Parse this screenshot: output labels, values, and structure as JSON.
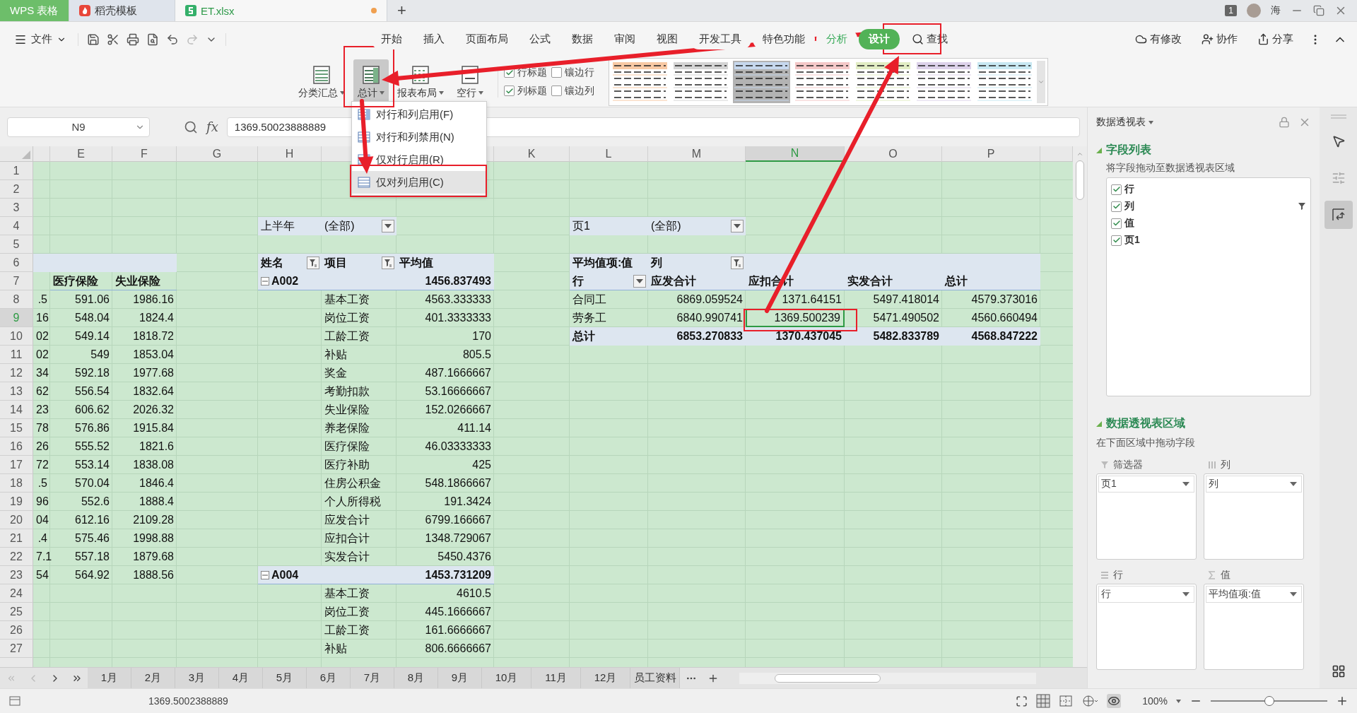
{
  "title_bar": {
    "tabs": [
      {
        "label": "WPS 表格",
        "kind": "home",
        "selected": false,
        "unsaved": false
      },
      {
        "label": "稻壳模板",
        "kind": "docer",
        "selected": false,
        "unsaved": false
      },
      {
        "label": "ET.xlsx",
        "kind": "sheet",
        "selected": true,
        "unsaved": true
      }
    ],
    "new_tab": "+",
    "badge": "1",
    "user": "海"
  },
  "menu_bar": {
    "file": "文件",
    "tabs": [
      {
        "label": "开始",
        "selected": false,
        "contextual": false
      },
      {
        "label": "插入",
        "selected": false,
        "contextual": false
      },
      {
        "label": "页面布局",
        "selected": false,
        "contextual": false
      },
      {
        "label": "公式",
        "selected": false,
        "contextual": false
      },
      {
        "label": "数据",
        "selected": false,
        "contextual": false
      },
      {
        "label": "审阅",
        "selected": false,
        "contextual": false
      },
      {
        "label": "视图",
        "selected": false,
        "contextual": false
      },
      {
        "label": "开发工具",
        "selected": false,
        "contextual": false
      },
      {
        "label": "特色功能",
        "selected": false,
        "contextual": false
      },
      {
        "label": "分析",
        "selected": false,
        "contextual": true
      },
      {
        "label": "设计",
        "selected": true,
        "contextual": true
      }
    ],
    "search": "查找",
    "actions": [
      {
        "label": "有修改",
        "kind": "cloud"
      },
      {
        "label": "协作",
        "kind": "people"
      },
      {
        "label": "分享",
        "kind": "share"
      }
    ]
  },
  "ribbon": {
    "buttons": [
      {
        "label": "分类汇总",
        "kind": "subtotal",
        "active": false
      },
      {
        "label": "总计",
        "kind": "total",
        "active": true
      },
      {
        "label": "报表布局",
        "kind": "layout",
        "active": false
      },
      {
        "label": "空行",
        "kind": "blank",
        "active": false
      }
    ],
    "options": [
      {
        "label": "行标题",
        "checked": true
      },
      {
        "label": "镶边行",
        "checked": false
      },
      {
        "label": "列标题",
        "checked": true
      },
      {
        "label": "镶边列",
        "checked": false
      }
    ],
    "styles": [
      {
        "color": "#f8c9a4",
        "selected": false
      },
      {
        "color": "#d4d4d4",
        "selected": false
      },
      {
        "color": "#c6d8ee",
        "selected": true
      },
      {
        "color": "#f4c8c8",
        "selected": false
      },
      {
        "color": "#e2edc4",
        "selected": false
      },
      {
        "color": "#ddd2ea",
        "selected": false
      },
      {
        "color": "#c8e8f2",
        "selected": false
      }
    ]
  },
  "dropdown": {
    "items": [
      {
        "label": "对行和列启用(F)",
        "selected": false
      },
      {
        "label": "对行和列禁用(N)",
        "selected": false
      },
      {
        "label": "仅对行启用(R)",
        "selected": false
      },
      {
        "label": "仅对列启用(C)",
        "selected": true
      }
    ]
  },
  "formula_bar": {
    "cell": "N9",
    "fx": "fx",
    "formula": "1369.50023888889"
  },
  "sheet": {
    "columns": [
      {
        "label": "E",
        "selected": false
      },
      {
        "label": "F",
        "selected": false
      },
      {
        "label": "G",
        "selected": false
      },
      {
        "label": "H",
        "selected": false
      },
      {
        "label": "K",
        "selected": false
      },
      {
        "label": "L",
        "selected": false
      },
      {
        "label": "M",
        "selected": false
      },
      {
        "label": "N",
        "selected": true
      },
      {
        "label": "O",
        "selected": false
      },
      {
        "label": "P",
        "selected": false
      }
    ],
    "rows": [
      {
        "label": "1",
        "selected": false
      },
      {
        "label": "2",
        "selected": false
      },
      {
        "label": "3",
        "selected": false
      },
      {
        "label": "4",
        "selected": false
      },
      {
        "label": "5",
        "selected": false
      },
      {
        "label": "6",
        "selected": false
      },
      {
        "label": "7",
        "selected": false
      },
      {
        "label": "8",
        "selected": false
      },
      {
        "label": "9",
        "selected": true
      },
      {
        "label": "10",
        "selected": false
      },
      {
        "label": "11",
        "selected": false
      },
      {
        "label": "12",
        "selected": false
      },
      {
        "label": "13",
        "selected": false
      },
      {
        "label": "14",
        "selected": false
      },
      {
        "label": "15",
        "selected": false
      },
      {
        "label": "16",
        "selected": false
      },
      {
        "label": "17",
        "selected": false
      },
      {
        "label": "18",
        "selected": false
      },
      {
        "label": "19",
        "selected": false
      },
      {
        "label": "20",
        "selected": false
      },
      {
        "label": "21",
        "selected": false
      },
      {
        "label": "22",
        "selected": false
      },
      {
        "label": "23",
        "selected": false
      },
      {
        "label": "24",
        "selected": false
      },
      {
        "label": "25",
        "selected": false
      },
      {
        "label": "26",
        "selected": false
      },
      {
        "label": "27",
        "selected": false
      }
    ],
    "salary_table": {
      "header": [
        "医疗保险",
        "失业保险"
      ],
      "rows": [
        [
          ".5",
          "591.06",
          "1986.16"
        ],
        [
          "16",
          "548.04",
          "1824.4"
        ],
        [
          "02",
          "549.14",
          "1818.72"
        ],
        [
          "02",
          "549",
          "1853.04"
        ],
        [
          "34",
          "592.18",
          "1977.68"
        ],
        [
          "62",
          "556.54",
          "1832.64"
        ],
        [
          "23",
          "606.62",
          "2026.32"
        ],
        [
          "78",
          "576.86",
          "1915.84"
        ],
        [
          "26",
          "555.52",
          "1821.6"
        ],
        [
          "72",
          "553.14",
          "1838.08"
        ],
        [
          ".5",
          "570.04",
          "1846.4"
        ],
        [
          "96",
          "552.6",
          "1888.4"
        ],
        [
          "04",
          "612.16",
          "2109.28"
        ],
        [
          ".4",
          "575.46",
          "1998.88"
        ],
        [
          "7.1",
          "557.18",
          "1879.68"
        ],
        [
          "54",
          "564.92",
          "1888.56"
        ]
      ]
    },
    "pivot_by_name": {
      "filter": {
        "label": "上半年",
        "value": "(全部)"
      },
      "header": [
        "姓名",
        "项目",
        "平均值"
      ],
      "groups": [
        {
          "name": "A002",
          "value": "1456.837493",
          "expanded": true,
          "items": [
            {
              "label": "基本工资",
              "value": "4563.333333"
            },
            {
              "label": "岗位工资",
              "value": "401.3333333"
            },
            {
              "label": "工龄工资",
              "value": "170"
            },
            {
              "label": "补贴",
              "value": "805.5"
            },
            {
              "label": "奖金",
              "value": "487.1666667"
            },
            {
              "label": "考勤扣款",
              "value": "53.16666667"
            },
            {
              "label": "失业保险",
              "value": "152.0266667"
            },
            {
              "label": "养老保险",
              "value": "411.14"
            },
            {
              "label": "医疗保险",
              "value": "46.03333333"
            },
            {
              "label": "医疗补助",
              "value": "425"
            },
            {
              "label": "住房公积金",
              "value": "548.1866667"
            },
            {
              "label": "个人所得税",
              "value": "191.3424"
            },
            {
              "label": "应发合计",
              "value": "6799.166667"
            },
            {
              "label": "应扣合计",
              "value": "1348.729067"
            },
            {
              "label": "实发合计",
              "value": "5450.4376"
            }
          ]
        },
        {
          "name": "A004",
          "value": "1453.731209",
          "expanded": true,
          "items": [
            {
              "label": "基本工资",
              "value": "4610.5"
            },
            {
              "label": "岗位工资",
              "value": "445.1666667"
            },
            {
              "label": "工龄工资",
              "value": "161.6666667"
            },
            {
              "label": "补贴",
              "value": "806.6666667"
            }
          ]
        }
      ]
    },
    "pivot_by_type": {
      "filter": {
        "label": "页1",
        "value": "(全部)"
      },
      "corner": "平均值项:值",
      "column_field": "列",
      "row_field": "行",
      "columns": [
        "应发合计",
        "应扣合计",
        "实发合计",
        "总计"
      ],
      "rows": [
        {
          "label": "合同工",
          "total": false,
          "values": [
            {
              "text": "6869.059524",
              "selected": false
            },
            {
              "text": "1371.64151",
              "selected": false
            },
            {
              "text": "5497.418014",
              "selected": false
            },
            {
              "text": "4579.373016",
              "selected": false
            }
          ]
        },
        {
          "label": "劳务工",
          "total": false,
          "values": [
            {
              "text": "6840.990741",
              "selected": false
            },
            {
              "text": "1369.500239",
              "selected": true
            },
            {
              "text": "5471.490502",
              "selected": false
            },
            {
              "text": "4560.660494",
              "selected": false
            }
          ]
        },
        {
          "label": "总计",
          "total": true,
          "values": [
            {
              "text": "6853.270833",
              "selected": false
            },
            {
              "text": "1370.437045",
              "selected": false
            },
            {
              "text": "5482.833789",
              "selected": false
            },
            {
              "text": "4568.847222",
              "selected": false
            }
          ]
        }
      ]
    }
  },
  "sheet_tabs": [
    "1月",
    "2月",
    "3月",
    "4月",
    "5月",
    "6月",
    "7月",
    "8月",
    "9月",
    "10月",
    "11月",
    "12月",
    "员工资料"
  ],
  "pivot_panel": {
    "title": "数据透视表",
    "field_list_title": "字段列表",
    "field_list_hint": "将字段拖动至数据透视表区域",
    "fields": [
      {
        "label": "行",
        "checked": true,
        "filtered": false
      },
      {
        "label": "列",
        "checked": true,
        "filtered": true
      },
      {
        "label": "值",
        "checked": true,
        "filtered": false
      },
      {
        "label": "页1",
        "checked": true,
        "filtered": false
      }
    ],
    "areas_title": "数据透视表区域",
    "areas_hint": "在下面区域中拖动字段",
    "areas": [
      {
        "title": "筛选器",
        "kind": "filter",
        "field": "页1"
      },
      {
        "title": "列",
        "kind": "columns",
        "field": "列"
      },
      {
        "title": "行",
        "kind": "rows",
        "field": "行"
      },
      {
        "title": "值",
        "kind": "values",
        "field": "平均值项:值"
      }
    ]
  },
  "side_tools": [
    {
      "kind": "select",
      "selected": false
    },
    {
      "kind": "settings",
      "selected": false
    },
    {
      "kind": "pivot",
      "selected": true
    }
  ],
  "status_bar": {
    "value": "1369.5002388889",
    "zoom": {
      "label": "100%",
      "level": 0.5
    }
  }
}
